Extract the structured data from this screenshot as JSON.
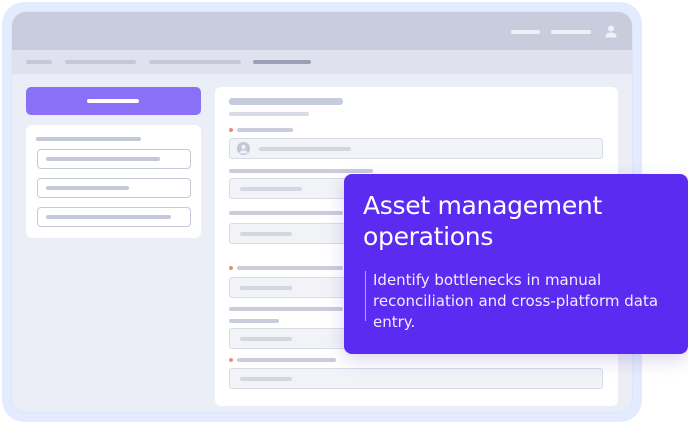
{
  "callout": {
    "title": "Asset management operations",
    "description": "Identify bottlenecks in manual reconciliation and cross-platform data entry."
  },
  "icons": {
    "user": "user-icon",
    "avatar": "avatar-icon"
  },
  "colors": {
    "accent": "#5c2bf2",
    "button": "#8a6ff7",
    "required": "#ef8a80",
    "titlebar": "#c8ccdc"
  }
}
